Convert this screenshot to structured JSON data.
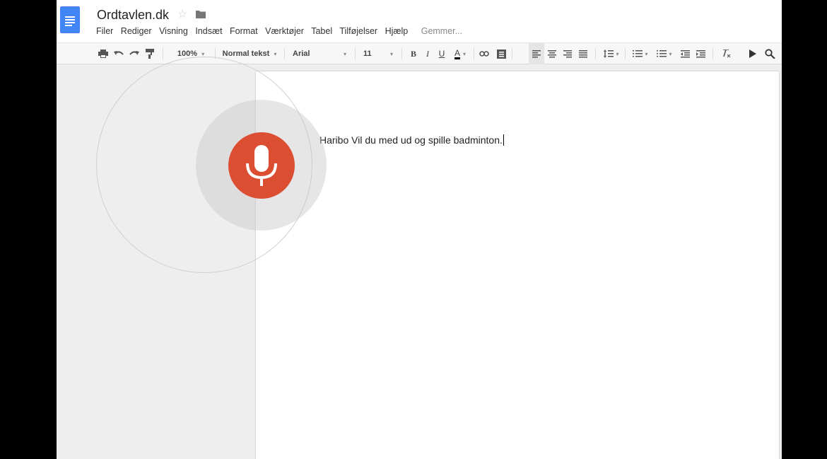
{
  "app": {
    "title": "Ordtavlen.dk",
    "menu": [
      "Filer",
      "Rediger",
      "Visning",
      "Indsæt",
      "Format",
      "Værktøjer",
      "Tabel",
      "Tilføjelser",
      "Hjælp"
    ],
    "save_status": "Gemmer..."
  },
  "toolbar": {
    "zoom": "100%",
    "style": "Normal tekst",
    "font": "Arial",
    "font_size": "11",
    "bold": "B",
    "italic": "I",
    "underline": "U",
    "text_color": "A"
  },
  "document": {
    "text": "Haribo Vil du med ud og spille badminton."
  },
  "colors": {
    "mic": "#dc4e32",
    "brand": "#4285f4"
  },
  "icons": {
    "logo": "docs-logo-icon",
    "star": "star-icon",
    "folder": "folder-icon",
    "mic": "microphone-icon"
  }
}
